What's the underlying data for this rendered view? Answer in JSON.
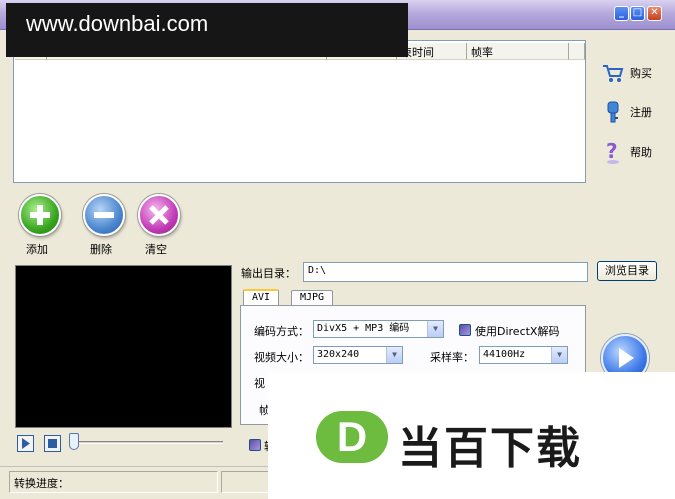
{
  "watermark_top": "www.downbai.com",
  "titlebar": {
    "minimize": "_",
    "maximize": "□",
    "close": "✕"
  },
  "filelist": {
    "columns": [
      "束时间",
      "帧率"
    ]
  },
  "side": {
    "buy": "购买",
    "register": "注册",
    "help": "帮助",
    "buy_icon": "cart-icon",
    "register_icon": "key-icon",
    "help_icon": "help-icon"
  },
  "actions": {
    "add": "添加",
    "delete": "删除",
    "clear": "清空"
  },
  "output": {
    "label": "输出目录：",
    "value": "D:\\",
    "browse": "浏览目录"
  },
  "tabs": [
    "AVI",
    "MJPG"
  ],
  "avi": {
    "codec_label": "编码方式：",
    "codec_value": "DivX5 + MP3 编码",
    "directx_label": "使用DirectX解码",
    "size_label": "视频大小：",
    "size_value": "320x240",
    "samplerate_label": "采样率：",
    "samplerate_value": "44100Hz",
    "partial_label_1": "视",
    "partial_label_2": "帧"
  },
  "partial_checkbox_label": "转",
  "status": {
    "progress_label": "转换进度："
  },
  "watermark_bottom": {
    "logo_letter": "D",
    "text": "当百下载"
  },
  "colors": {
    "accent_blue": "#2b5fdc",
    "titlebar": "#b6aadc",
    "logo_green": "#6dbb3f"
  }
}
